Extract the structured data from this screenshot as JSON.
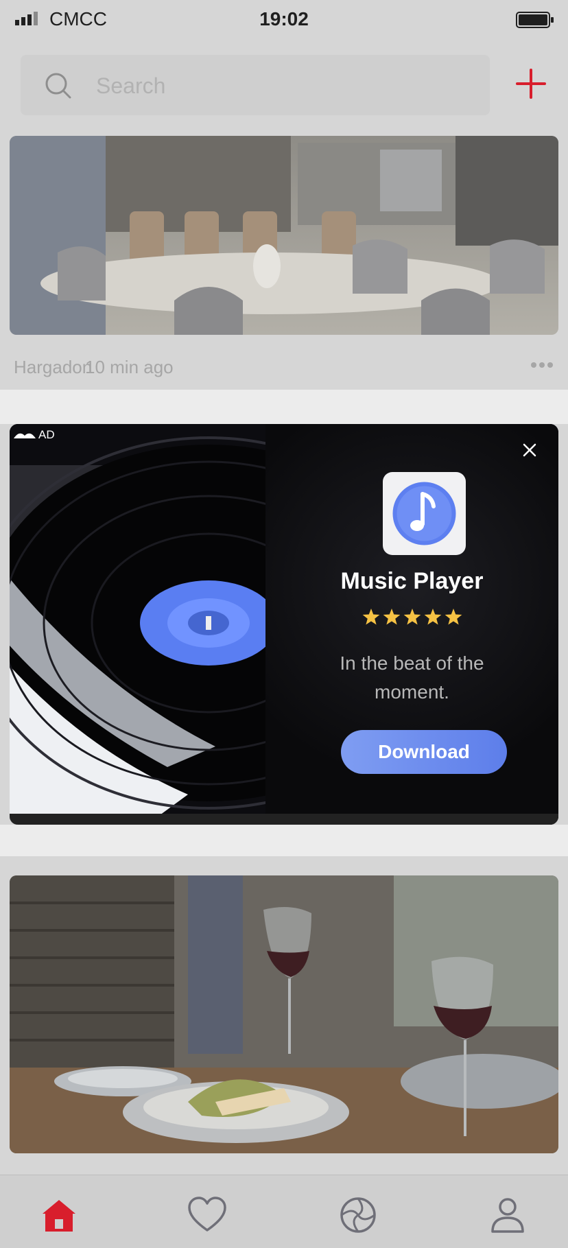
{
  "status_bar": {
    "carrier": "CMCC",
    "time": "19:02"
  },
  "search": {
    "placeholder": "Search"
  },
  "feed": {
    "post_1": {
      "author": "Hargadon",
      "time_ago": "10 min ago"
    },
    "ad": {
      "badge": "AD",
      "app_name": "Music Player",
      "rating_stars": 5,
      "rating_max": 5,
      "tagline": "In the beat of the moment.",
      "cta_label": "Download"
    }
  },
  "tabs": {
    "icons": [
      "home-icon",
      "heart-icon",
      "aperture-icon",
      "user-icon"
    ],
    "active": "home-icon"
  },
  "colors": {
    "accent": "#d81e2c",
    "cta": "#6d8cf0",
    "star": "#f6c244"
  }
}
